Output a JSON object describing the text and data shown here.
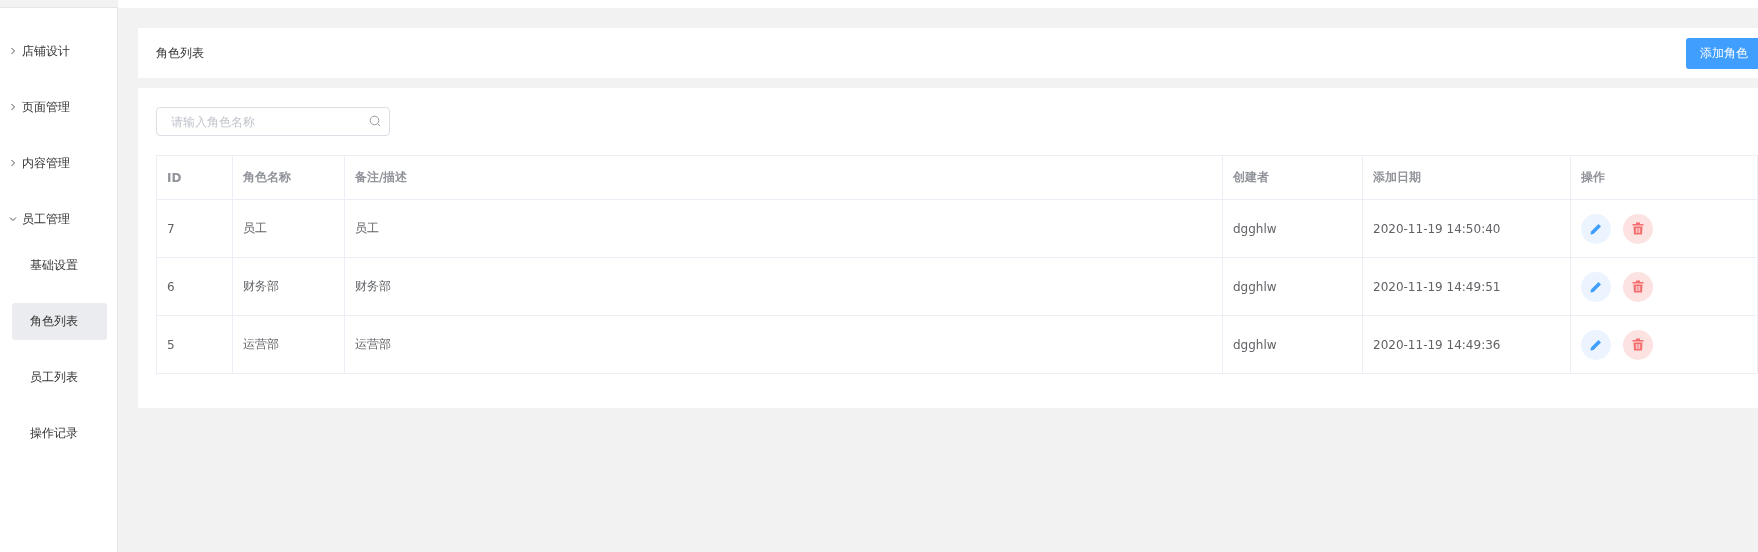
{
  "sidebar": {
    "items": [
      {
        "label": "店铺设计",
        "expanded": false
      },
      {
        "label": "页面管理",
        "expanded": false
      },
      {
        "label": "内容管理",
        "expanded": false
      },
      {
        "label": "员工管理",
        "expanded": true,
        "children": [
          {
            "label": "基础设置",
            "selected": false
          },
          {
            "label": "角色列表",
            "selected": true
          },
          {
            "label": "员工列表",
            "selected": false
          },
          {
            "label": "操作记录",
            "selected": false
          }
        ]
      }
    ]
  },
  "header": {
    "title": "角色列表",
    "add_button": "添加角色"
  },
  "search": {
    "placeholder": "请输入角色名称"
  },
  "table": {
    "columns": [
      "ID",
      "角色名称",
      "备注/描述",
      "创建者",
      "添加日期",
      "操作"
    ],
    "rows": [
      {
        "id": "7",
        "name": "员工",
        "description": "员工",
        "creator": "dgghlw",
        "date": "2020-11-19 14:50:40"
      },
      {
        "id": "6",
        "name": "财务部",
        "description": "财务部",
        "creator": "dgghlw",
        "date": "2020-11-19 14:49:51"
      },
      {
        "id": "5",
        "name": "运营部",
        "description": "运营部",
        "creator": "dgghlw",
        "date": "2020-11-19 14:49:36"
      }
    ]
  }
}
